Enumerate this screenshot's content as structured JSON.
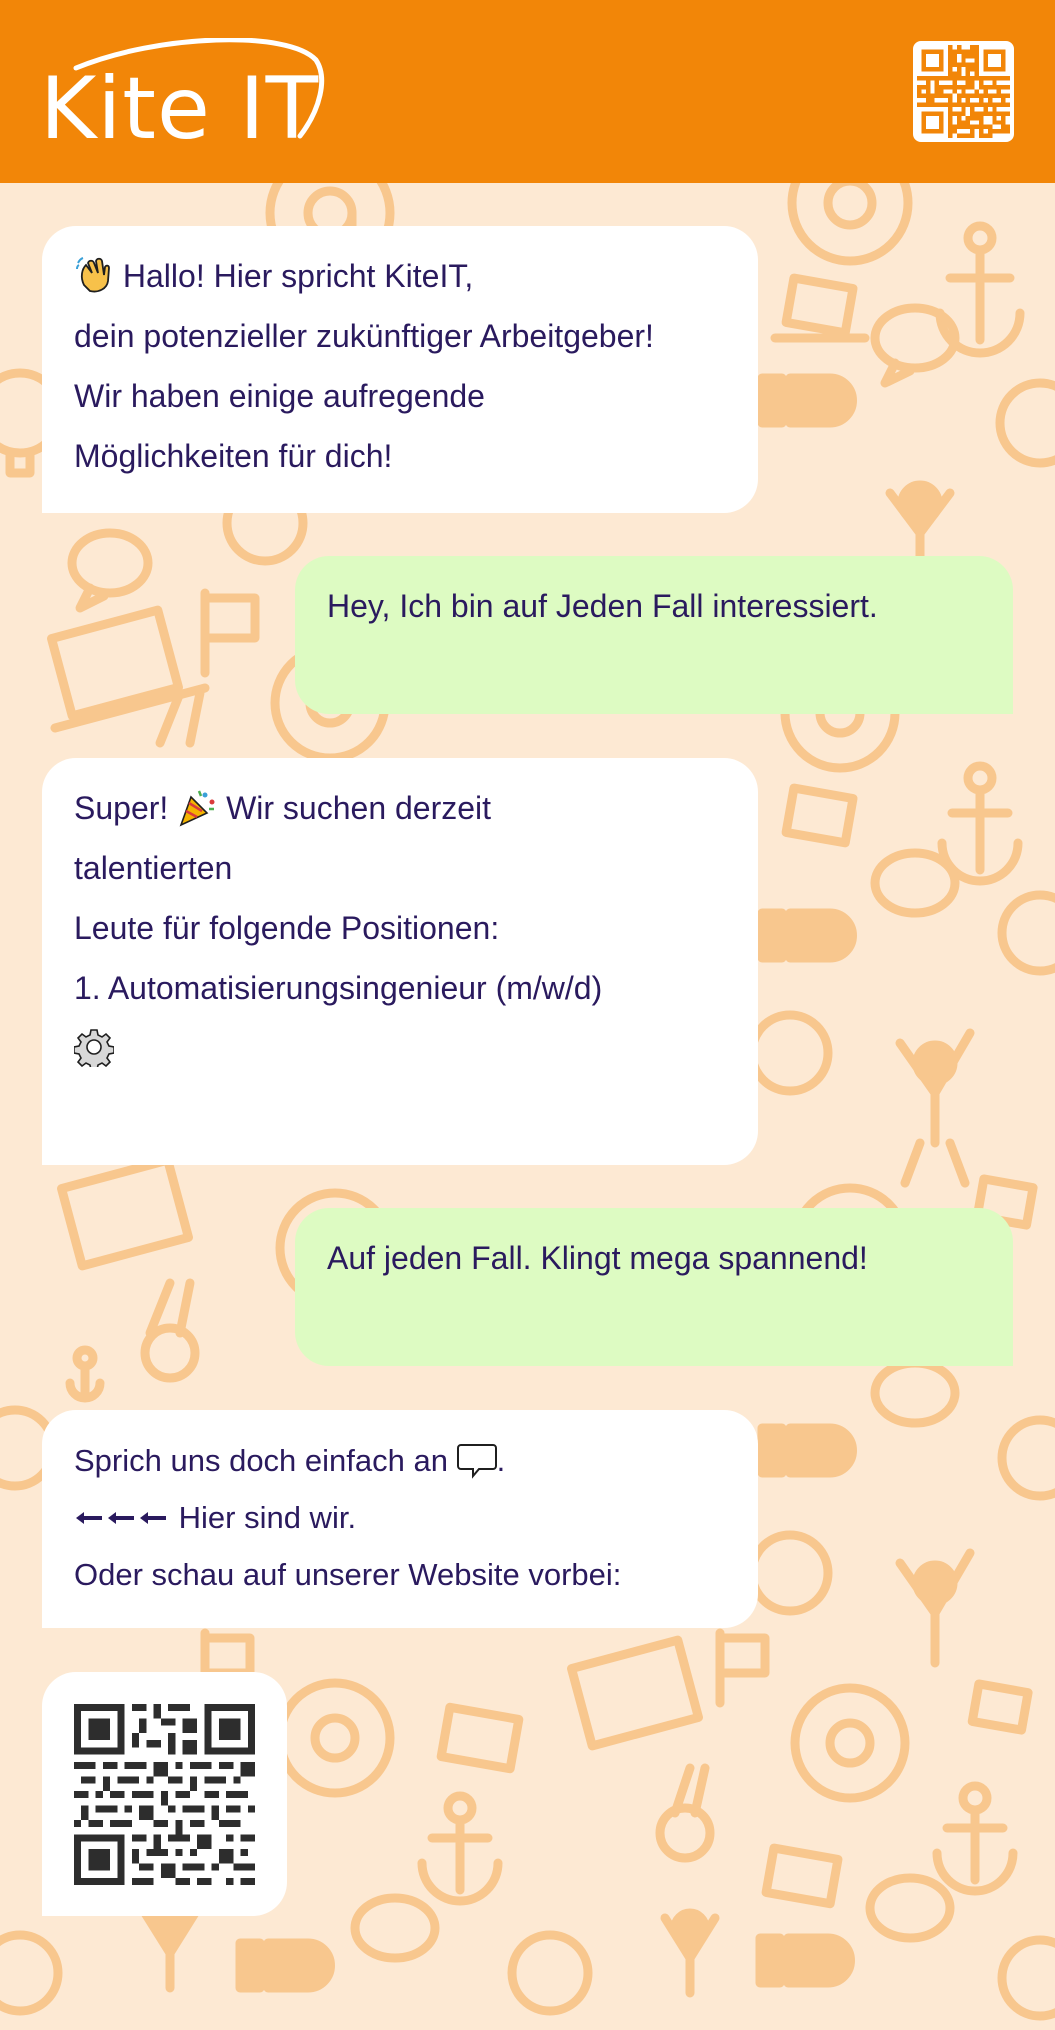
{
  "header": {
    "logo_text": "Kite IT",
    "qr_icon": "qr-code-icon",
    "background_color": "#f28608"
  },
  "background": {
    "color": "#fde9d3",
    "pattern_color": "#f8c78e",
    "pattern_icons": [
      "at-sign-icon",
      "anchor-icon",
      "laptop-icon",
      "speech-bubble-icon",
      "thumbs-up-icon",
      "lightbulb-icon",
      "person-cheering-icon",
      "flag-icon",
      "peace-hand-icon"
    ]
  },
  "messages": [
    {
      "side": "incoming",
      "lines": [
        "Hallo! Hier spricht KiteIT,",
        "dein potenzieller zukünftiger Arbeitgeber!",
        "Wir haben einige aufregende",
        "Möglichkeiten für dich!"
      ],
      "emoji": "waving-hand-icon"
    },
    {
      "side": "outgoing",
      "lines": [
        "Hey, Ich bin auf Jeden Fall interessiert."
      ]
    },
    {
      "side": "incoming",
      "lines": [
        "Super!",
        "Wir suchen derzeit",
        "talentierten",
        "Leute für folgende Positionen:",
        "1. Automatisierungsingenieur (m/w/d)"
      ],
      "emojis": [
        "party-popper-icon",
        "gear-icon"
      ]
    },
    {
      "side": "outgoing",
      "lines": [
        "Auf jeden Fall. Klingt mega spannend!"
      ]
    },
    {
      "side": "incoming",
      "lines": [
        "Sprich uns doch einfach an",
        ".",
        "Hier sind wir.",
        "Oder schau auf unserer Website vorbei:"
      ],
      "emojis": [
        "speech-bubble-icon",
        "arrows-left-icon"
      ]
    },
    {
      "side": "incoming",
      "content": "qr-code-icon"
    }
  ],
  "colors": {
    "text": "#2a1a5e",
    "incoming_bubble": "#ffffff",
    "outgoing_bubble": "#ddfbc2"
  }
}
